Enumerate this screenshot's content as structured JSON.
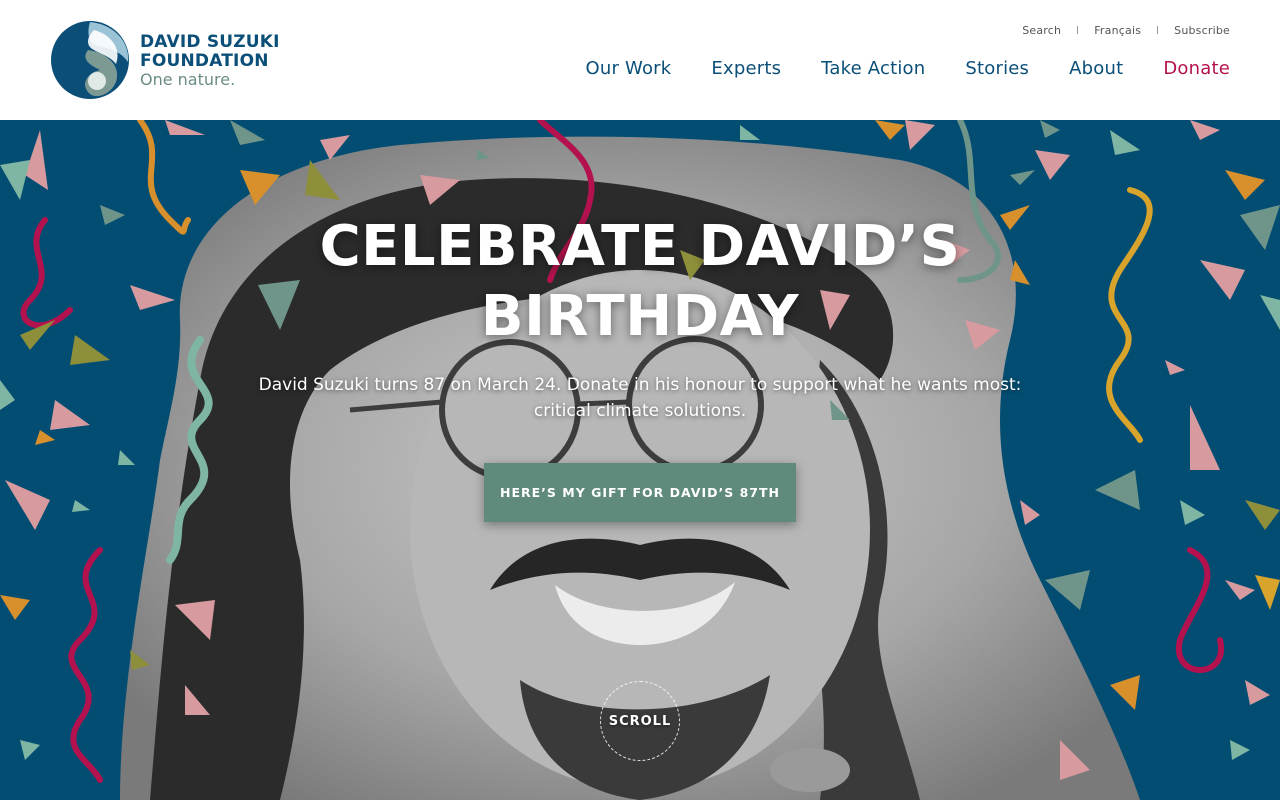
{
  "brand": {
    "name_line1": "DAVID SUZUKI",
    "name_line2": "FOUNDATION",
    "tagline": "One nature.",
    "colors": {
      "navy": "#0b4f79",
      "sage": "#6b8c86",
      "donate": "#b3124e",
      "hero_bg": "#044d72",
      "cta": "#5f8a7c"
    }
  },
  "utility_nav": [
    {
      "label": "Search"
    },
    {
      "label": "Français"
    },
    {
      "label": "Subscribe"
    }
  ],
  "main_nav": [
    {
      "label": "Our Work"
    },
    {
      "label": "Experts"
    },
    {
      "label": "Take Action"
    },
    {
      "label": "Stories"
    },
    {
      "label": "About"
    },
    {
      "label": "Donate"
    }
  ],
  "hero": {
    "title_line1": "CELEBRATE DAVID’S",
    "title_line2": "BIRTHDAY",
    "subtitle_line1": "David Suzuki turns 87 on March 24. Donate in his honour to support what he wants most:",
    "subtitle_line2": "critical climate solutions.",
    "cta_label": "HERE’S MY GIFT FOR DAVID’S 87TH",
    "scroll_label": "SCROLL"
  }
}
